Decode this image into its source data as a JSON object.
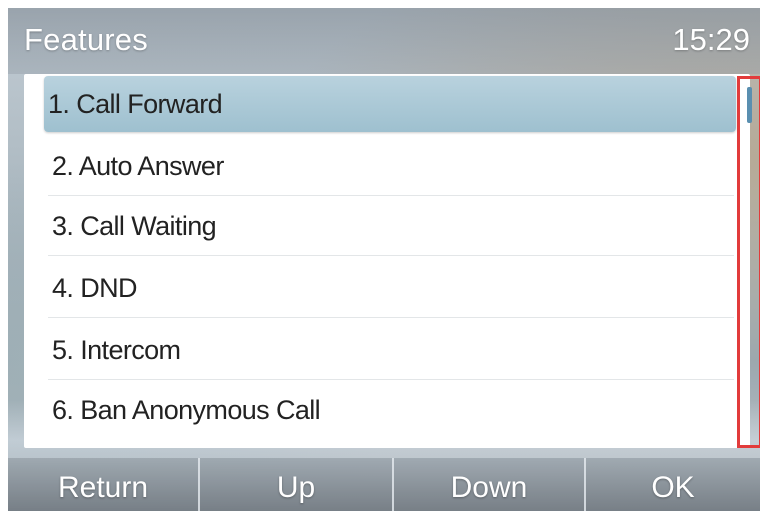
{
  "header": {
    "title": "Features",
    "time": "15:29"
  },
  "menu": {
    "items": [
      {
        "label": "1. Call Forward",
        "selected": true
      },
      {
        "label": "2. Auto Answer",
        "selected": false
      },
      {
        "label": "3. Call Waiting",
        "selected": false
      },
      {
        "label": "4. DND",
        "selected": false
      },
      {
        "label": "5. Intercom",
        "selected": false
      },
      {
        "label": "6. Ban Anonymous Call",
        "selected": false
      }
    ]
  },
  "softkeys": {
    "return": "Return",
    "up": "Up",
    "down": "Down",
    "ok": "OK"
  },
  "colors": {
    "selection": "#a8c8d6",
    "scroll_highlight": "#e23b3b",
    "scroll_thumb": "#5a8fb0"
  }
}
